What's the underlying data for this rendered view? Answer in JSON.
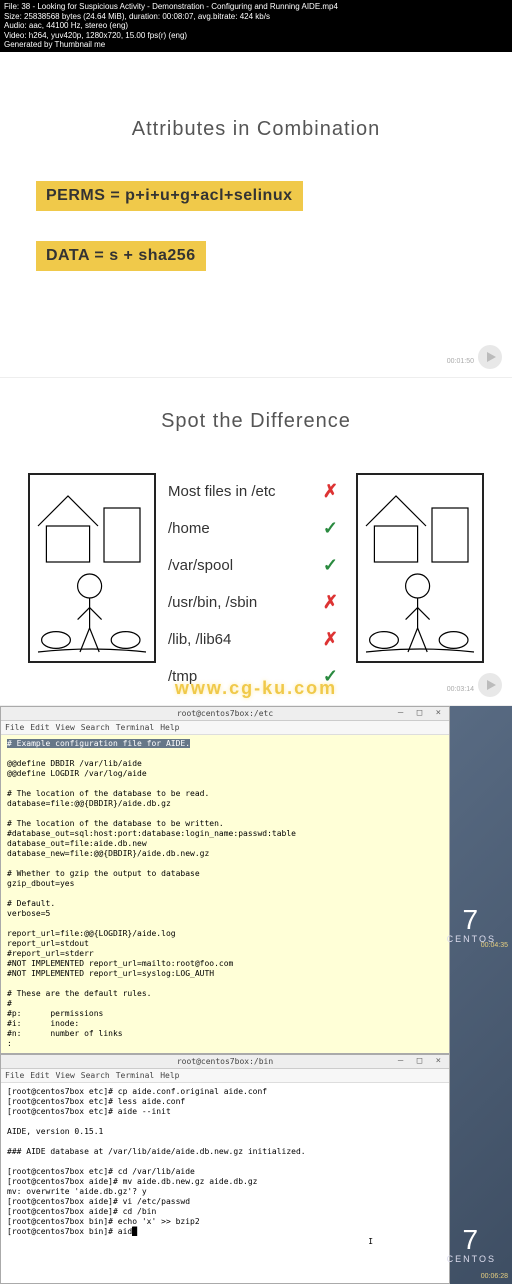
{
  "meta": {
    "l1": "File: 38 - Looking for Suspicious Activity - Demonstration - Configuring and Running AIDE.mp4",
    "l2": "Size: 25838568 bytes (24.64 MiB), duration: 00:08:07, avg.bitrate: 424 kb/s",
    "l3": "Audio: aac, 44100 Hz, stereo (eng)",
    "l4": "Video: h264, yuv420p, 1280x720, 15.00 fps(r) (eng)",
    "l5": "Generated by Thumbnail me"
  },
  "slide1": {
    "title": "Attributes in Combination",
    "line1": "PERMS = p+i+u+g+acl+selinux",
    "line2": "DATA = s + sha256",
    "timestamp": "00:01:50"
  },
  "slide2": {
    "title": "Spot the Difference",
    "timestamp": "00:03:14",
    "watermark": "www.cg-ku.com",
    "rows": [
      {
        "label": "Most files in /etc",
        "ok": false
      },
      {
        "label": "/home",
        "ok": true
      },
      {
        "label": "/var/spool",
        "ok": true
      },
      {
        "label": "/usr/bin, /sbin",
        "ok": false
      },
      {
        "label": "/lib, /lib64",
        "ok": false
      },
      {
        "label": "/tmp",
        "ok": true
      }
    ]
  },
  "term1": {
    "title": "root@centos7box:/etc",
    "menu": [
      "File",
      "Edit",
      "View",
      "Search",
      "Terminal",
      "Help"
    ],
    "timestamp": "00:04:35",
    "body_sel": "# Example configuration file for AIDE.",
    "body": "\n\n@@define DBDIR /var/lib/aide\n@@define LOGDIR /var/log/aide\n\n# The location of the database to be read.\ndatabase=file:@@{DBDIR}/aide.db.gz\n\n# The location of the database to be written.\n#database_out=sql:host:port:database:login_name:passwd:table\ndatabase_out=file:aide.db.new\ndatabase_new=file:@@{DBDIR}/aide.db.new.gz\n\n# Whether to gzip the output to database\ngzip_dbout=yes\n\n# Default.\nverbose=5\n\nreport_url=file:@@{LOGDIR}/aide.log\nreport_url=stdout\n#report_url=stderr\n#NOT IMPLEMENTED report_url=mailto:root@foo.com\n#NOT IMPLEMENTED report_url=syslog:LOG_AUTH\n\n# These are the default rules.\n#\n#p:      permissions\n#i:      inode:\n#n:      number of links\n:"
  },
  "term2": {
    "title": "root@centos7box:/bin",
    "menu": [
      "File",
      "Edit",
      "View",
      "Search",
      "Terminal",
      "Help"
    ],
    "timestamp": "00:06:28",
    "body": "[root@centos7box etc]# cp aide.conf.original aide.conf\n[root@centos7box etc]# less aide.conf\n[root@centos7box etc]# aide --init\n\nAIDE, version 0.15.1\n\n### AIDE database at /var/lib/aide/aide.db.new.gz initialized.\n\n[root@centos7box etc]# cd /var/lib/aide\n[root@centos7box aide]# mv aide.db.new.gz aide.db.gz\nmv: overwrite 'aide.db.gz'? y\n[root@centos7box aide]# vi /etc/passwd\n[root@centos7box aide]# cd /bin\n[root@centos7box bin]# echo 'x' >> bzip2\n[root@centos7box bin]# aid"
  },
  "centos": {
    "num": "7",
    "word": "CENTOS"
  }
}
